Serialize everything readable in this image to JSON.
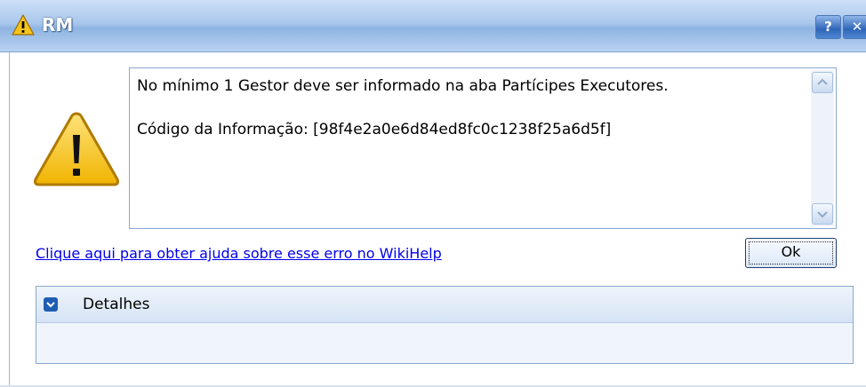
{
  "window": {
    "title": "RM",
    "help_button": "?",
    "close_button": "✕"
  },
  "message": {
    "line1": "No mínimo 1 Gestor deve ser informado na aba Partícipes Executores.",
    "line2": "Código da Informação: [98f4e2a0e6d84ed8fc0c1238f25a6d5f]"
  },
  "help_link": "Clique aqui para obter ajuda sobre esse erro no WikiHelp",
  "ok_button": "Ok",
  "details": {
    "label": "Detalhes"
  },
  "icons": {
    "title": "warning-icon",
    "main": "warning-icon",
    "scroll_up": "chevron-up-icon",
    "scroll_down": "chevron-down-icon",
    "details_toggle": "chevron-down-icon"
  },
  "colors": {
    "titlebar": "#a9c7ec",
    "link": "#0000ee",
    "warning_fill": "#f6c21c",
    "border": "#8ba7cc"
  }
}
